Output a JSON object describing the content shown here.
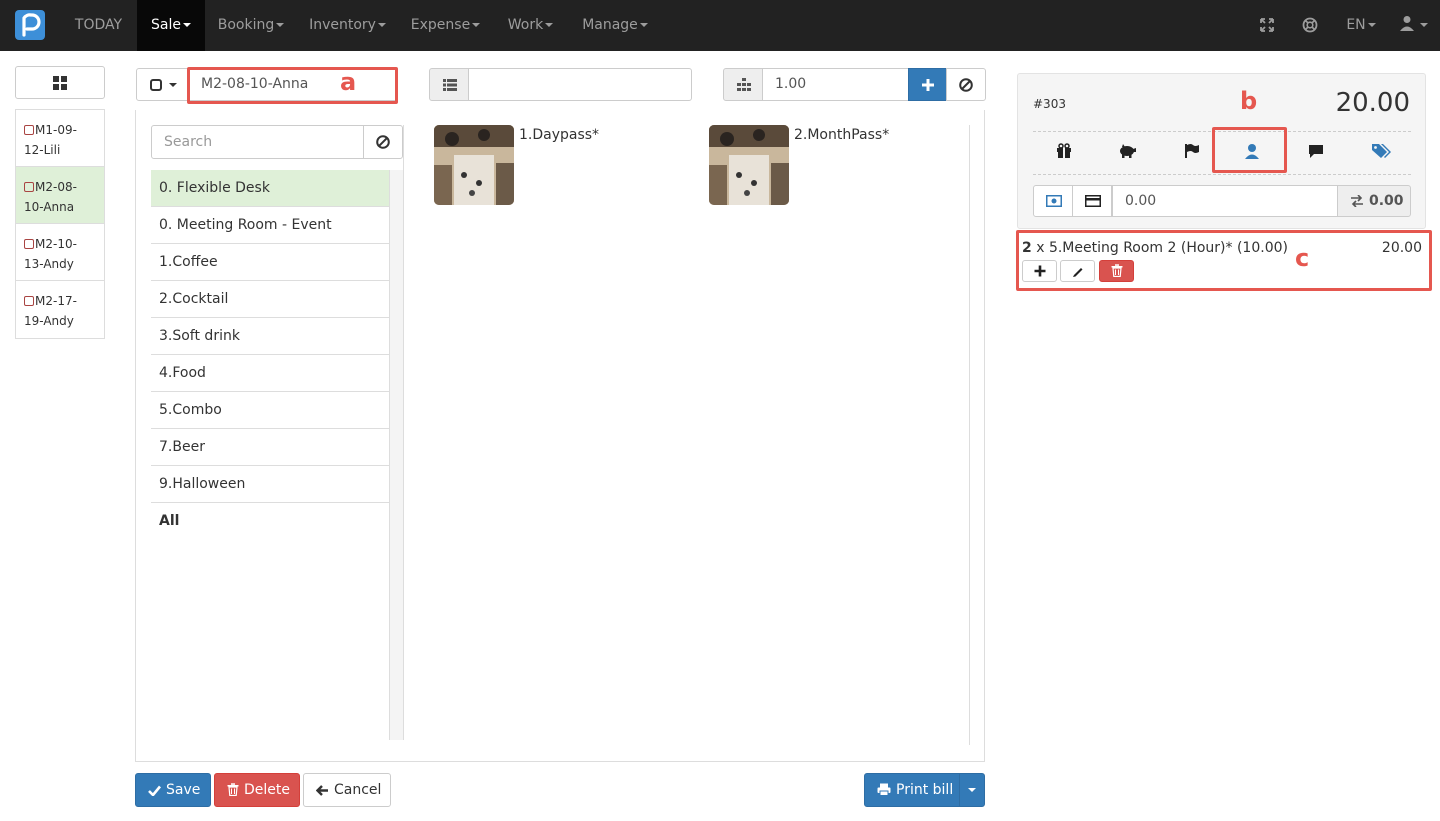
{
  "navbar": {
    "items": [
      {
        "label": "TODAY",
        "dropdown": false
      },
      {
        "label": "Sale",
        "dropdown": true,
        "active": true
      },
      {
        "label": "Booking",
        "dropdown": true
      },
      {
        "label": "Inventory",
        "dropdown": true
      },
      {
        "label": "Expense",
        "dropdown": true
      },
      {
        "label": "Work",
        "dropdown": true
      },
      {
        "label": "Manage",
        "dropdown": true
      }
    ],
    "language": "EN",
    "icons": [
      "fullscreen-icon",
      "support-icon",
      "user-icon"
    ],
    "brand_color": "#3d8fd8"
  },
  "tables": [
    {
      "line1": "M1-09-",
      "line2": "12-Lili"
    },
    {
      "line1": "M2-08-",
      "line2": "10-Anna",
      "active": true
    },
    {
      "line1": "M2-10-",
      "line2": "13-Andy"
    },
    {
      "line1": "M2-17-",
      "line2": "19-Andy"
    }
  ],
  "order": {
    "table_name": "M2-08-10-Anna",
    "note_value": "",
    "quantity": "1.00"
  },
  "search": {
    "placeholder": "Search"
  },
  "categories": [
    {
      "label": "0. Flexible Desk",
      "active": true
    },
    {
      "label": "0. Meeting Room - Event"
    },
    {
      "label": "1.Coffee"
    },
    {
      "label": "2.Cocktail"
    },
    {
      "label": "3.Soft drink"
    },
    {
      "label": "4.Food"
    },
    {
      "label": "5.Combo"
    },
    {
      "label": "7.Beer"
    },
    {
      "label": "9.Halloween"
    },
    {
      "label": "All",
      "bold": true
    }
  ],
  "products": [
    {
      "name": "1.Daypass*"
    },
    {
      "name": "2.MonthPass*"
    }
  ],
  "bill": {
    "number": "#303",
    "total": "20.00",
    "payment_value": "0.00",
    "change": "0.00",
    "line_items": [
      {
        "qty": "2",
        "description": "x 5.Meeting Room 2 (Hour)* (10.00)",
        "amount": "20.00"
      }
    ]
  },
  "annotations": {
    "a": "a",
    "b": "b",
    "c": "c",
    "color": "#e5574f"
  },
  "footer": {
    "save": "Save",
    "delete": "Delete",
    "cancel": "Cancel",
    "print": "Print bill"
  }
}
